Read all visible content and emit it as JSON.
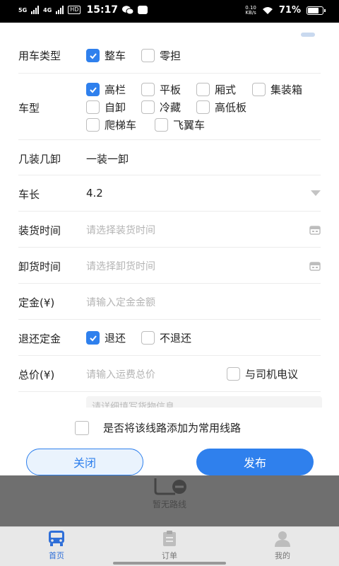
{
  "status_bar": {
    "network": "5G",
    "network2": "4G",
    "hd": "HD",
    "time": "15:17",
    "speed": "0.10",
    "speed_unit": "KB/s",
    "battery": "71%"
  },
  "form": {
    "vehicle_usage": {
      "label": "用车类型",
      "options": [
        {
          "label": "整车",
          "checked": true
        },
        {
          "label": "零担",
          "checked": false
        }
      ]
    },
    "vehicle_model": {
      "label": "车型",
      "options": [
        {
          "label": "高栏",
          "checked": true
        },
        {
          "label": "平板",
          "checked": false
        },
        {
          "label": "厢式",
          "checked": false
        },
        {
          "label": "集装箱",
          "checked": false
        },
        {
          "label": "自卸",
          "checked": false
        },
        {
          "label": "冷藏",
          "checked": false
        },
        {
          "label": "高低板",
          "checked": false
        },
        {
          "label": "爬梯车",
          "checked": false
        },
        {
          "label": "飞翼车",
          "checked": false
        }
      ]
    },
    "load_unload": {
      "label": "几装几卸",
      "value": "一装一卸"
    },
    "length": {
      "label": "车长",
      "value": "4.2"
    },
    "load_time": {
      "label": "装货时间",
      "placeholder": "请选择装货时间"
    },
    "unload_time": {
      "label": "卸货时间",
      "placeholder": "请选择卸货时间"
    },
    "deposit": {
      "label": "定金(¥)",
      "placeholder": "请输入定金金额"
    },
    "refund_deposit": {
      "label": "退还定金",
      "options": [
        {
          "label": "退还",
          "checked": true
        },
        {
          "label": "不退还",
          "checked": false
        }
      ]
    },
    "total_price": {
      "label": "总价(¥)",
      "placeholder": "请输入运费总价",
      "negotiate": {
        "label": "与司机电议",
        "checked": false
      }
    },
    "cargo_info_placeholder": "请详细填写货物信息"
  },
  "save_route": {
    "label": "是否将该线路添加为常用线路",
    "checked": false
  },
  "buttons": {
    "close": "关闭",
    "publish": "发布"
  },
  "background_page": {
    "empty_text": "暂无路线"
  },
  "bottom_nav": [
    {
      "label": "首页",
      "icon": "bus-icon",
      "active": true
    },
    {
      "label": "订单",
      "icon": "clipboard-icon",
      "active": false
    },
    {
      "label": "我的",
      "icon": "person-icon",
      "active": false
    }
  ],
  "colors": {
    "accent": "#2f80ed",
    "placeholder": "#b4b4b4"
  }
}
